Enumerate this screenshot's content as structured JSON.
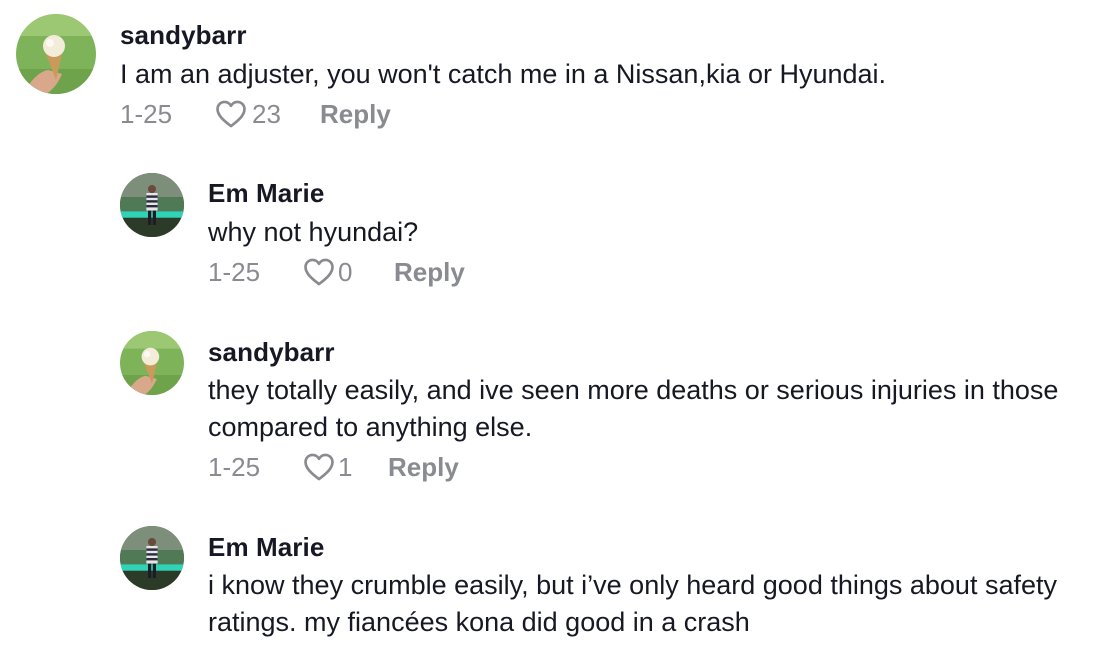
{
  "comments": [
    {
      "username": "sandybarr",
      "text": "I am an adjuster, you won't catch me in a Nissan,kia or Hyundai.",
      "date": "1-25",
      "likes": "23",
      "reply_label": "Reply",
      "avatar_icon": "ice-cream-cone-avatar"
    },
    {
      "username": "Em Marie",
      "text": "why not hyundai?",
      "date": "1-25",
      "likes": "0",
      "reply_label": "Reply",
      "avatar_icon": "person-in-garden-avatar"
    },
    {
      "username": "sandybarr",
      "text": "they totally easily, and ive seen more deaths or serious injuries in those compared to anything else.",
      "date": "1-25",
      "likes": "1",
      "reply_label": "Reply",
      "avatar_icon": "ice-cream-cone-avatar"
    },
    {
      "username": "Em Marie",
      "text": "i know they crumble easily, but i’ve only heard good things about safety ratings. my fiancées kona did good in a crash",
      "date": "",
      "likes": "",
      "reply_label": "",
      "avatar_icon": "person-in-garden-avatar"
    }
  ],
  "colors": {
    "text": "#161823",
    "meta": "#8a8b91",
    "background": "#ffffff"
  }
}
